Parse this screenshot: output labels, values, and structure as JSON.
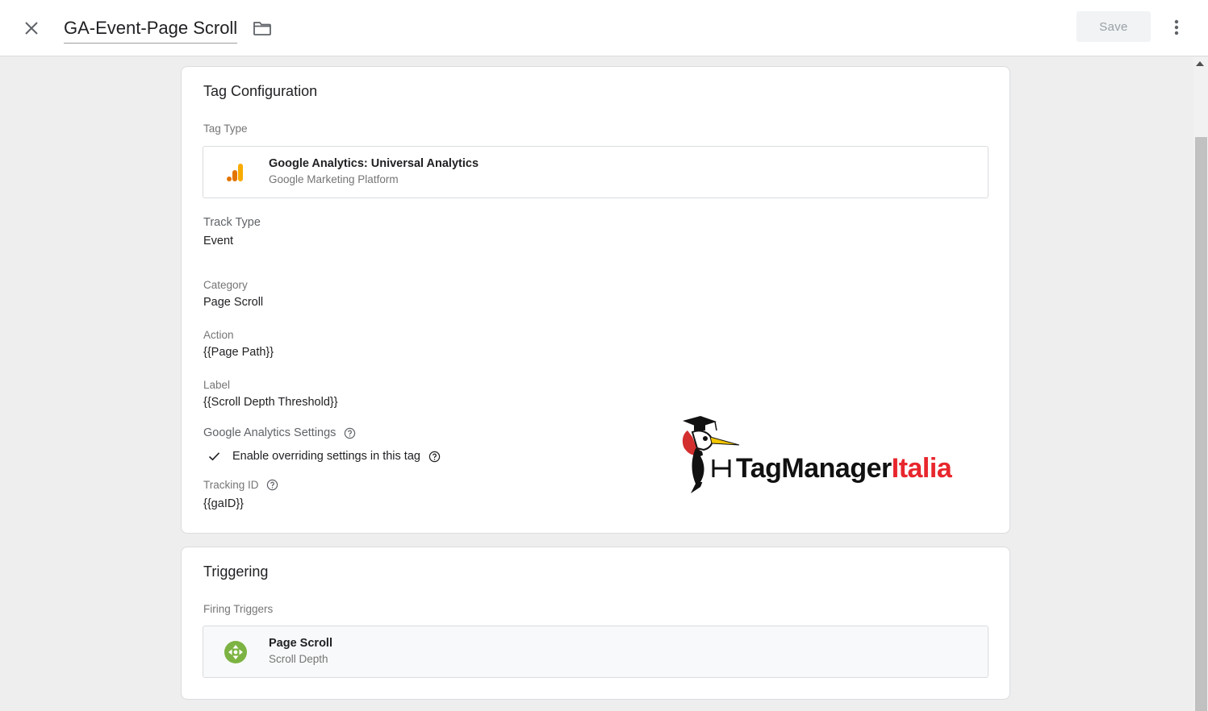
{
  "header": {
    "title": "GA-Event-Page Scroll",
    "save_label": "Save"
  },
  "tag_configuration": {
    "section_title": "Tag Configuration",
    "tag_type_label": "Tag Type",
    "tag_type": {
      "name": "Google Analytics: Universal Analytics",
      "subtitle": "Google Marketing Platform",
      "icon": "google-analytics-icon"
    },
    "track_type_label": "Track Type",
    "track_type_value": "Event",
    "category_label": "Category",
    "category_value": "Page Scroll",
    "action_label": "Action",
    "action_value": "{{Page Path}}",
    "label_label": "Label",
    "label_value": "{{Scroll Depth Threshold}}",
    "ga_settings_label": "Google Analytics Settings",
    "override_checked": true,
    "override_label": "Enable overriding settings in this tag",
    "tracking_id_label": "Tracking ID",
    "tracking_id_value": "{{gaID}}"
  },
  "watermark": {
    "text_part1": "TagManager",
    "text_part2": "Italia",
    "color_dark": "#111111",
    "color_accent": "#e8262d"
  },
  "triggering": {
    "section_title": "Triggering",
    "firing_triggers_label": "Firing Triggers",
    "triggers": [
      {
        "name": "Page Scroll",
        "subtitle": "Scroll Depth",
        "icon": "scroll-depth-icon",
        "color": "#7cb342"
      }
    ]
  }
}
